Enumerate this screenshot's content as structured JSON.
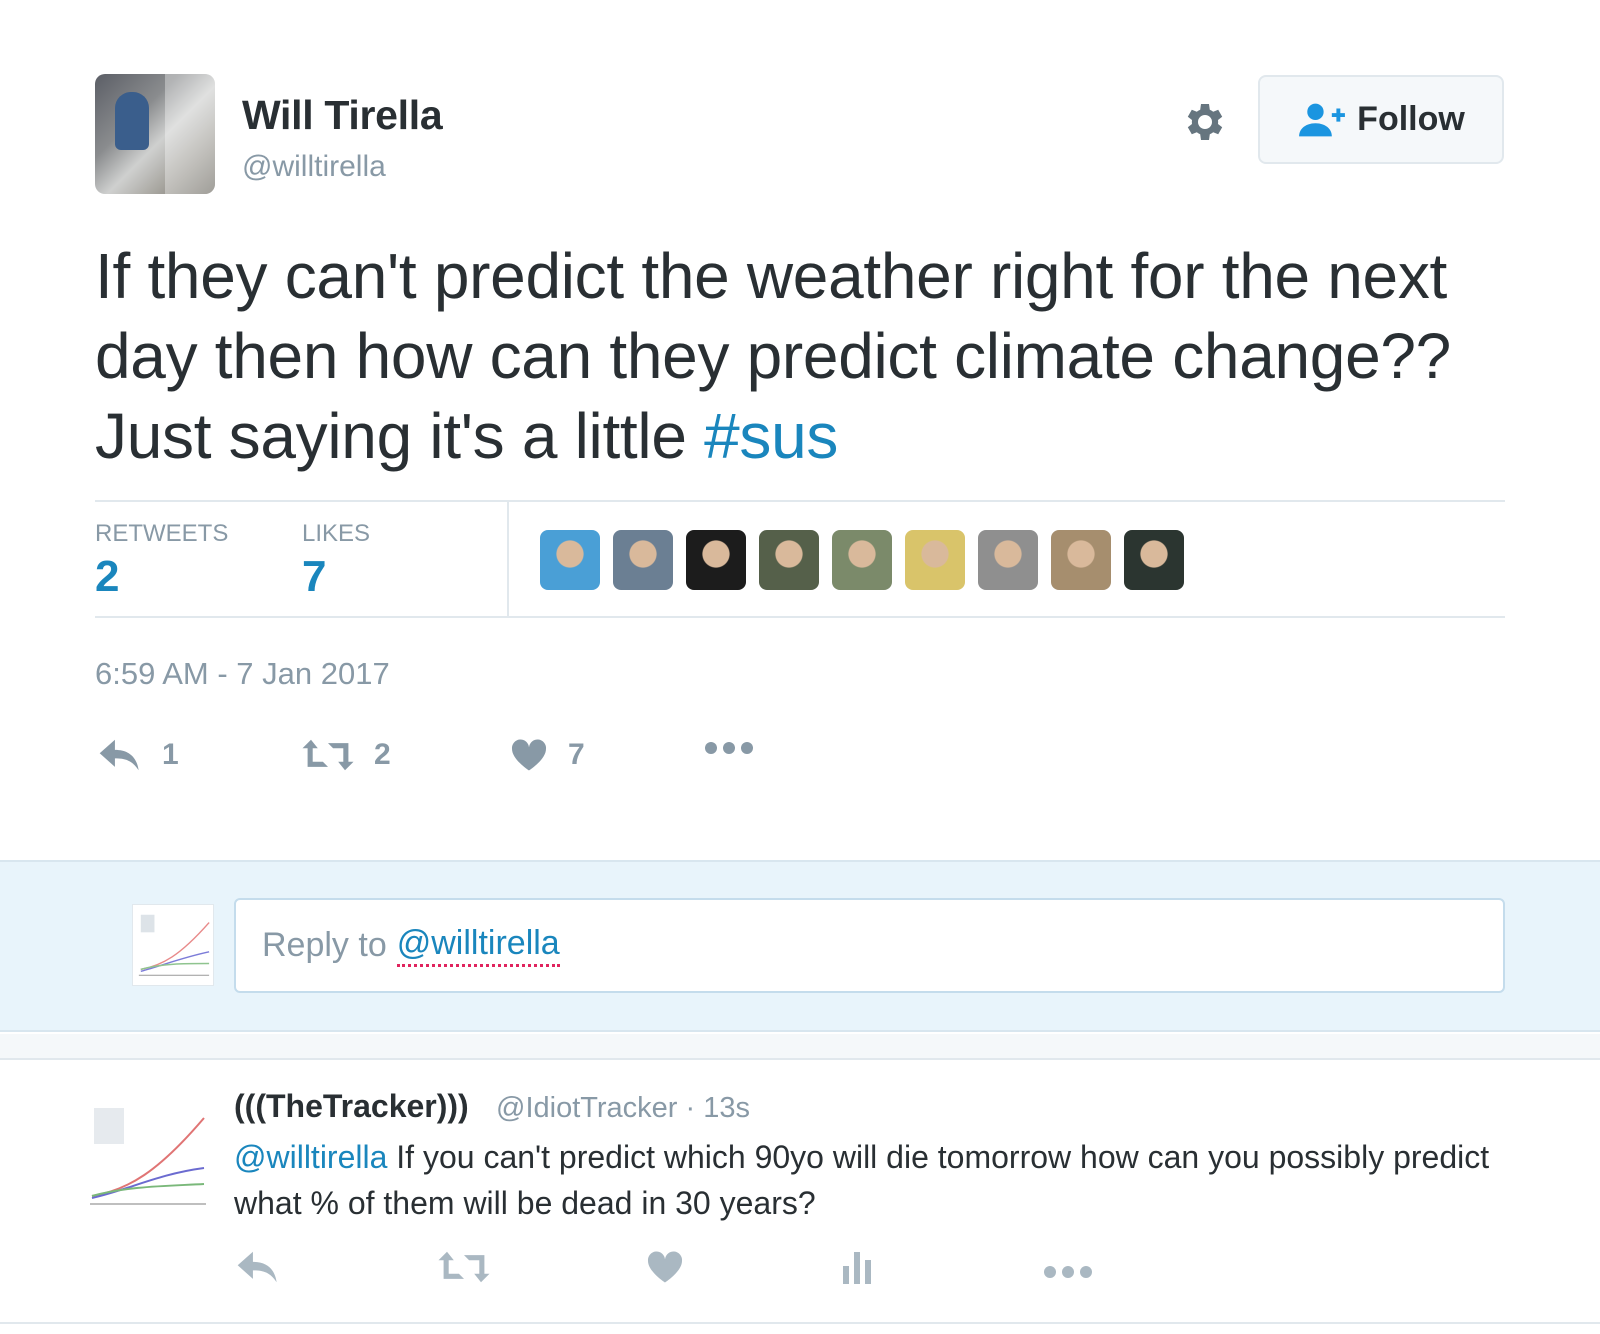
{
  "tweet": {
    "user": {
      "name": "Will Tirella",
      "handle": "@willtirella"
    },
    "follow_label": "Follow",
    "text_main": "If they can't predict the weather right for the next day then how can they predict climate change?? Just saying it's a little ",
    "hashtag": "#sus",
    "stats": {
      "retweets_label": "RETWEETS",
      "retweets_value": "2",
      "likes_label": "LIKES",
      "likes_value": "7"
    },
    "likers": [
      {
        "name": "liker-1",
        "color": "#4a9fd6"
      },
      {
        "name": "liker-2",
        "color": "#6b7f93"
      },
      {
        "name": "liker-3",
        "color": "#1c1c1c"
      },
      {
        "name": "liker-4",
        "color": "#55604a"
      },
      {
        "name": "liker-5",
        "color": "#7b8a6a"
      },
      {
        "name": "liker-6",
        "color": "#d9c46a"
      },
      {
        "name": "liker-7",
        "color": "#8f8f8f"
      },
      {
        "name": "liker-8",
        "color": "#a68e6e"
      },
      {
        "name": "liker-9",
        "color": "#2b3530"
      }
    ],
    "timestamp": "6:59 AM - 7 Jan 2017",
    "actions": {
      "reply_count": "1",
      "retweet_count": "2",
      "like_count": "7"
    }
  },
  "reply_box": {
    "prefix": "Reply to",
    "mention": "@willtirella"
  },
  "reply_tweet": {
    "name": "(((TheTracker)))",
    "handle_time": "@IdiotTracker · 13s",
    "mention": "@willtirella",
    "text": " If you can't predict which 90yo will die tomorrow how can you possibly predict what % of them will be dead in 30 years?"
  },
  "colors": {
    "link": "#1a86bd",
    "muted": "#8899a6",
    "reply_bg": "#e8f4fb"
  }
}
